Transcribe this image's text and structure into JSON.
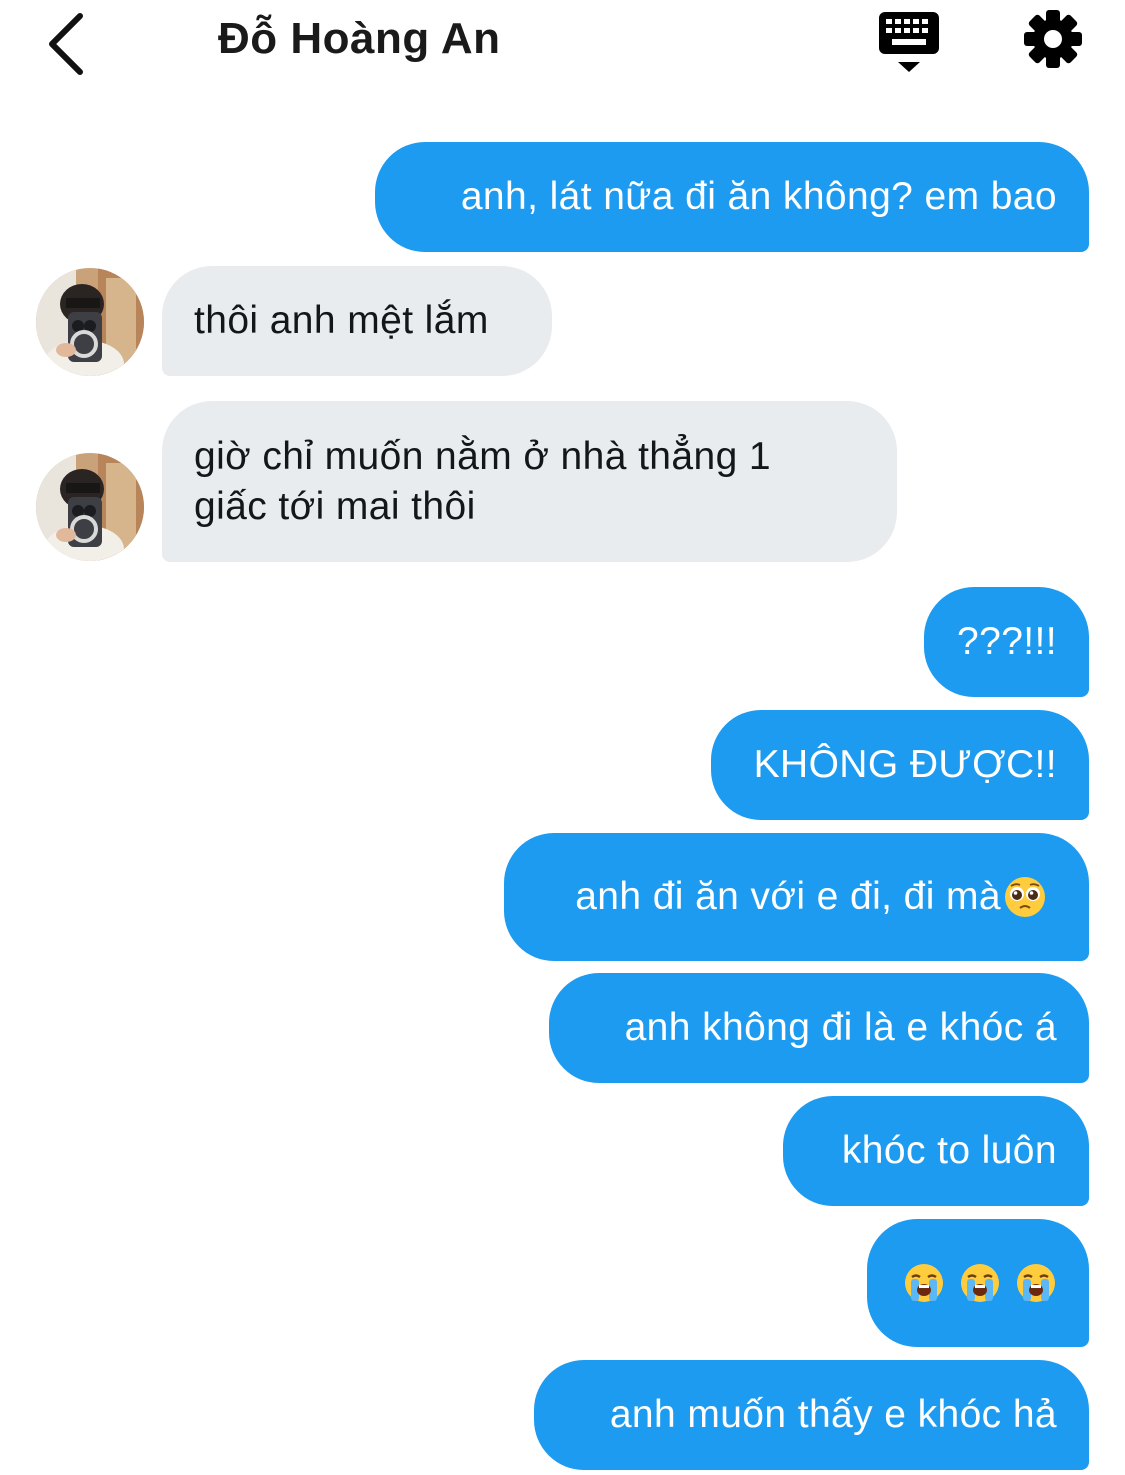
{
  "header": {
    "title": "Đỗ Hoàng An",
    "back_icon": "chevron-left-icon",
    "keyboard_icon": "keyboard-icon",
    "settings_icon": "gear-icon"
  },
  "colors": {
    "outgoing_bubble": "#1d9bf0",
    "incoming_bubble": "#e8ecef",
    "outgoing_text": "#ffffff",
    "incoming_text": "#14171a"
  },
  "messages": [
    {
      "direction": "outgoing",
      "text": "anh, lát nữa đi ăn không? em bao"
    },
    {
      "direction": "incoming",
      "text": "thôi anh mệt lắm"
    },
    {
      "direction": "incoming",
      "lines": [
        "giờ chỉ muốn nằm ở nhà thẳng 1",
        "giấc tới mai thôi"
      ]
    },
    {
      "direction": "outgoing",
      "text": "???!!!"
    },
    {
      "direction": "outgoing",
      "text": "KHÔNG ĐƯỢC!!"
    },
    {
      "direction": "outgoing",
      "text": "anh đi ăn với e đi, đi mà",
      "emoji": "pleading-face"
    },
    {
      "direction": "outgoing",
      "text": "anh không đi là e khóc á"
    },
    {
      "direction": "outgoing",
      "text": "khóc to luôn"
    },
    {
      "direction": "outgoing",
      "emoji": "loudly-crying-face ×3"
    },
    {
      "direction": "outgoing",
      "text": "anh muốn thấy e khóc hả"
    }
  ]
}
